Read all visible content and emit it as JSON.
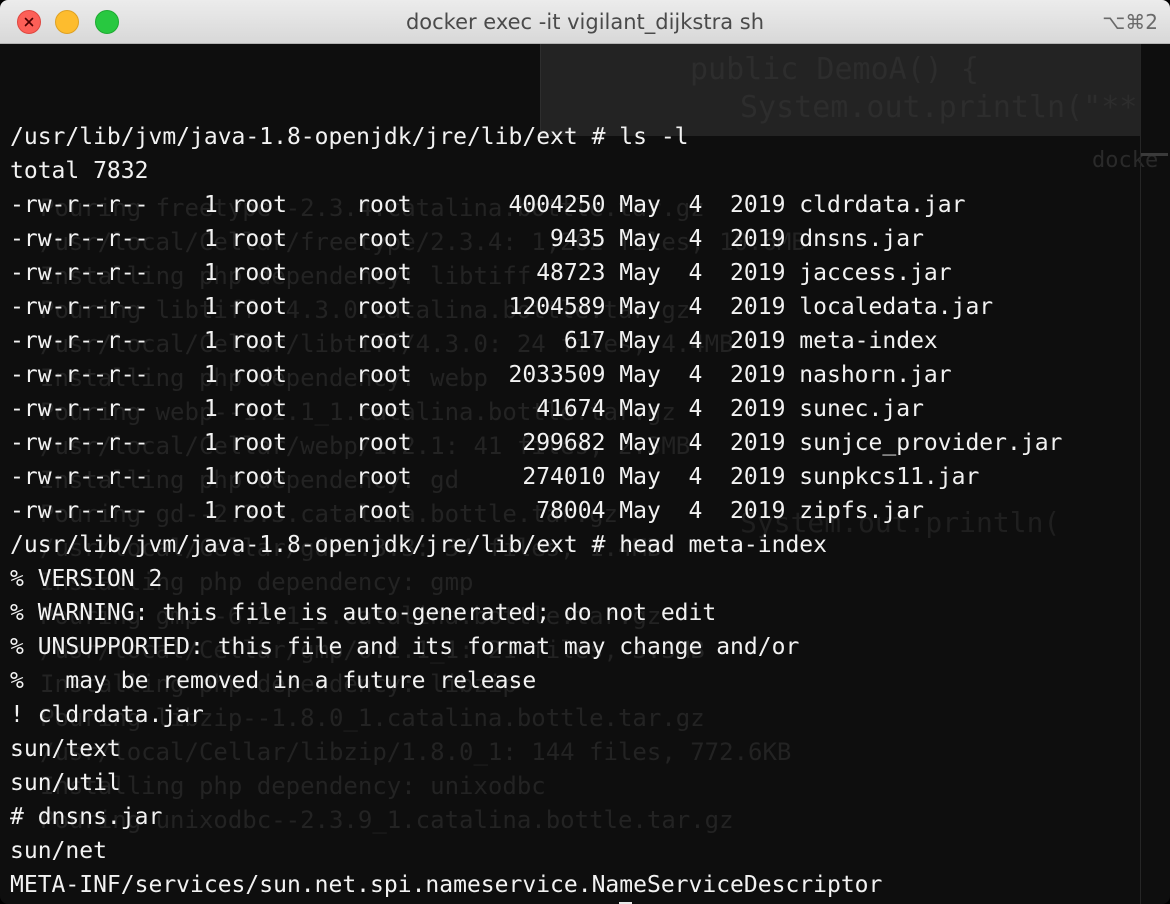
{
  "window": {
    "title": "docker exec -it vigilant_dijkstra sh",
    "shortcut": "⌥⌘2"
  },
  "terminal": {
    "lines": [
      "/usr/lib/jvm/java-1.8-openjdk/jre/lib/ext # ls -l",
      "total 7832",
      "-rw-r--r--    1 root     root       4004250 May  4  2019 cldrdata.jar",
      "-rw-r--r--    1 root     root          9435 May  4  2019 dnsns.jar",
      "-rw-r--r--    1 root     root         48723 May  4  2019 jaccess.jar",
      "-rw-r--r--    1 root     root       1204589 May  4  2019 localedata.jar",
      "-rw-r--r--    1 root     root           617 May  4  2019 meta-index",
      "-rw-r--r--    1 root     root       2033509 May  4  2019 nashorn.jar",
      "-rw-r--r--    1 root     root         41674 May  4  2019 sunec.jar",
      "-rw-r--r--    1 root     root        299682 May  4  2019 sunjce_provider.jar",
      "-rw-r--r--    1 root     root        274010 May  4  2019 sunpkcs11.jar",
      "-rw-r--r--    1 root     root         78004 May  4  2019 zipfs.jar",
      "/usr/lib/jvm/java-1.8-openjdk/jre/lib/ext # head meta-index",
      "% VERSION 2",
      "% WARNING: this file is auto-generated; do not edit",
      "% UNSUPPORTED: this file and its format may change and/or",
      "%   may be removed in a future release",
      "! cldrdata.jar",
      "sun/text",
      "sun/util",
      "# dnsns.jar",
      "sun/net",
      "META-INF/services/sun.net.spi.nameservice.NameServiceDescriptor"
    ],
    "prompt": "/usr/lib/jvm/java-1.8-openjdk/jre/lib/ext # "
  },
  "background_window": {
    "code_line_1": "public DemoA() {",
    "code_line_2": "System.out.println(\"**",
    "code_line_3": "System.out.println(",
    "tab_label": "docke",
    "log_lines": [
      "Pouring freetype--2.3.4.catalina.bottle.tar.gz",
      "/usr/local/Cellar/freetype/2.3.4: 1,262 files, 10.6MB",
      "Installing php dependency: libtiff",
      "Pouring libtiff--4.3.0.catalina.bottle.tar.gz",
      "/usr/local/Cellar/libtiff/4.3.0: 24 files, 4.4MB",
      "Installing php dependency: webp",
      "Pouring webp--1.2.1_1.catalina.bottle.tar.gz",
      "/usr/local/Cellar/webp/1.2.1: 41 files, 2.3MB",
      "Installing php dependency: gd",
      "Pouring gd--2.3.3.catalina.bottle.tar.gz",
      "/usr/local/Cellar/gd/2.3.3: 34 files, 1.4MB",
      "Installing php dependency: gmp",
      "Pouring gmp--6.2.1_1.catalina.bottle.tar.gz",
      "/usr/local/Cellar/gmp/6.2.1_1: 21 files, 3.3MB",
      "Installing php dependency: libzip",
      "Pouring libzip--1.8.0_1.catalina.bottle.tar.gz",
      "/usr/local/Cellar/libzip/1.8.0_1: 144 files, 772.6KB",
      "Installing php dependency: unixodbc",
      "Pouring unixodbc--2.3.9_1.catalina.bottle.tar.gz"
    ]
  },
  "colors": {
    "background": "#0e0e0e",
    "text": "#f2f2f2",
    "titlebar": "#e0e0e0",
    "close": "#fc5f57",
    "minimize": "#fdbc2e",
    "maximize": "#28c840"
  }
}
